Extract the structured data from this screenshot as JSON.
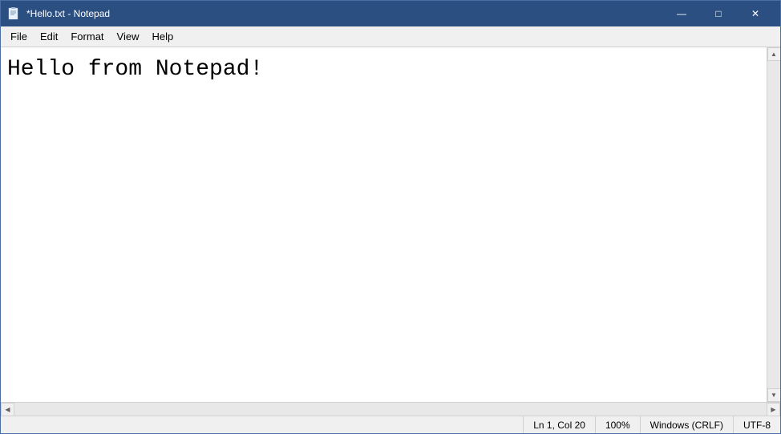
{
  "titleBar": {
    "icon": "notepad-icon",
    "title": "*Hello.txt - Notepad",
    "minimizeLabel": "—",
    "maximizeLabel": "□",
    "closeLabel": "✕"
  },
  "menuBar": {
    "items": [
      {
        "id": "file",
        "label": "File"
      },
      {
        "id": "edit",
        "label": "Edit"
      },
      {
        "id": "format",
        "label": "Format"
      },
      {
        "id": "view",
        "label": "View"
      },
      {
        "id": "help",
        "label": "Help"
      }
    ]
  },
  "editor": {
    "content": "Hello from Notepad!"
  },
  "statusBar": {
    "position": "Ln 1, Col 20",
    "zoom": "100%",
    "lineEnding": "Windows (CRLF)",
    "encoding": "UTF-8"
  }
}
